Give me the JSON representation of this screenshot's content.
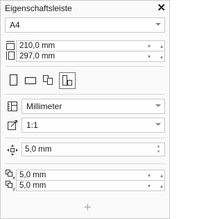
{
  "panel": {
    "title": "Eigenschaftsleiste",
    "close_glyph": "✕"
  },
  "page_size": {
    "value": "A4"
  },
  "width": {
    "value": "210,0 mm"
  },
  "height": {
    "value": "297,0 mm"
  },
  "units": {
    "value": "Millimeter"
  },
  "scale": {
    "value": "1:1"
  },
  "nudge": {
    "value": "5,0 mm"
  },
  "duplicate_x": {
    "value": "5,0 mm"
  },
  "duplicate_y": {
    "value": "5,0 mm"
  },
  "add_glyph": "+",
  "spin_glyphs": {
    "down": "▾",
    "up": "▴"
  },
  "colors": {
    "border": "#c9c9c9",
    "panel_bg": "#fafafa",
    "text": "#1a1a1a",
    "icon": "#333333"
  }
}
